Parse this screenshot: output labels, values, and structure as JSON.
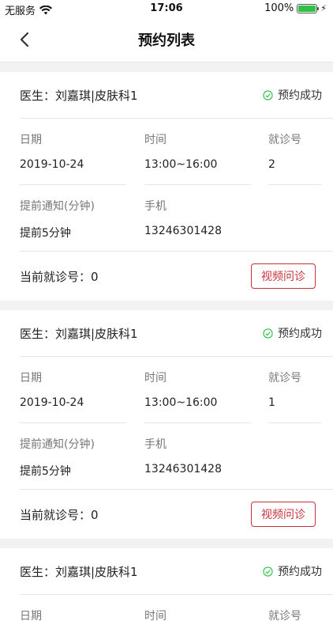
{
  "status_bar": {
    "carrier": "无服务",
    "time": "17:06",
    "battery": "100%"
  },
  "nav": {
    "title": "预约列表"
  },
  "labels": {
    "date": "日期",
    "time": "时间",
    "number": "就诊号",
    "notify": "提前通知(分钟)",
    "phone": "手机",
    "current_prefix": "当前就诊号：",
    "video_button": "视频问诊"
  },
  "appointments": [
    {
      "doctor": "医生：刘嘉琪|皮肤科1",
      "status": "预约成功",
      "date": "2019-10-24",
      "time": "13:00~16:00",
      "number": "2",
      "notify": "提前5分钟",
      "phone": "13246301428",
      "current": "0"
    },
    {
      "doctor": "医生：刘嘉琪|皮肤科1",
      "status": "预约成功",
      "date": "2019-10-24",
      "time": "13:00~16:00",
      "number": "1",
      "notify": "提前5分钟",
      "phone": "13246301428",
      "current": "0"
    },
    {
      "doctor": "医生：刘嘉琪|皮肤科1",
      "status": "预约成功"
    }
  ],
  "colors": {
    "accent_red": "#c8323c",
    "success_green": "#2fc045"
  }
}
